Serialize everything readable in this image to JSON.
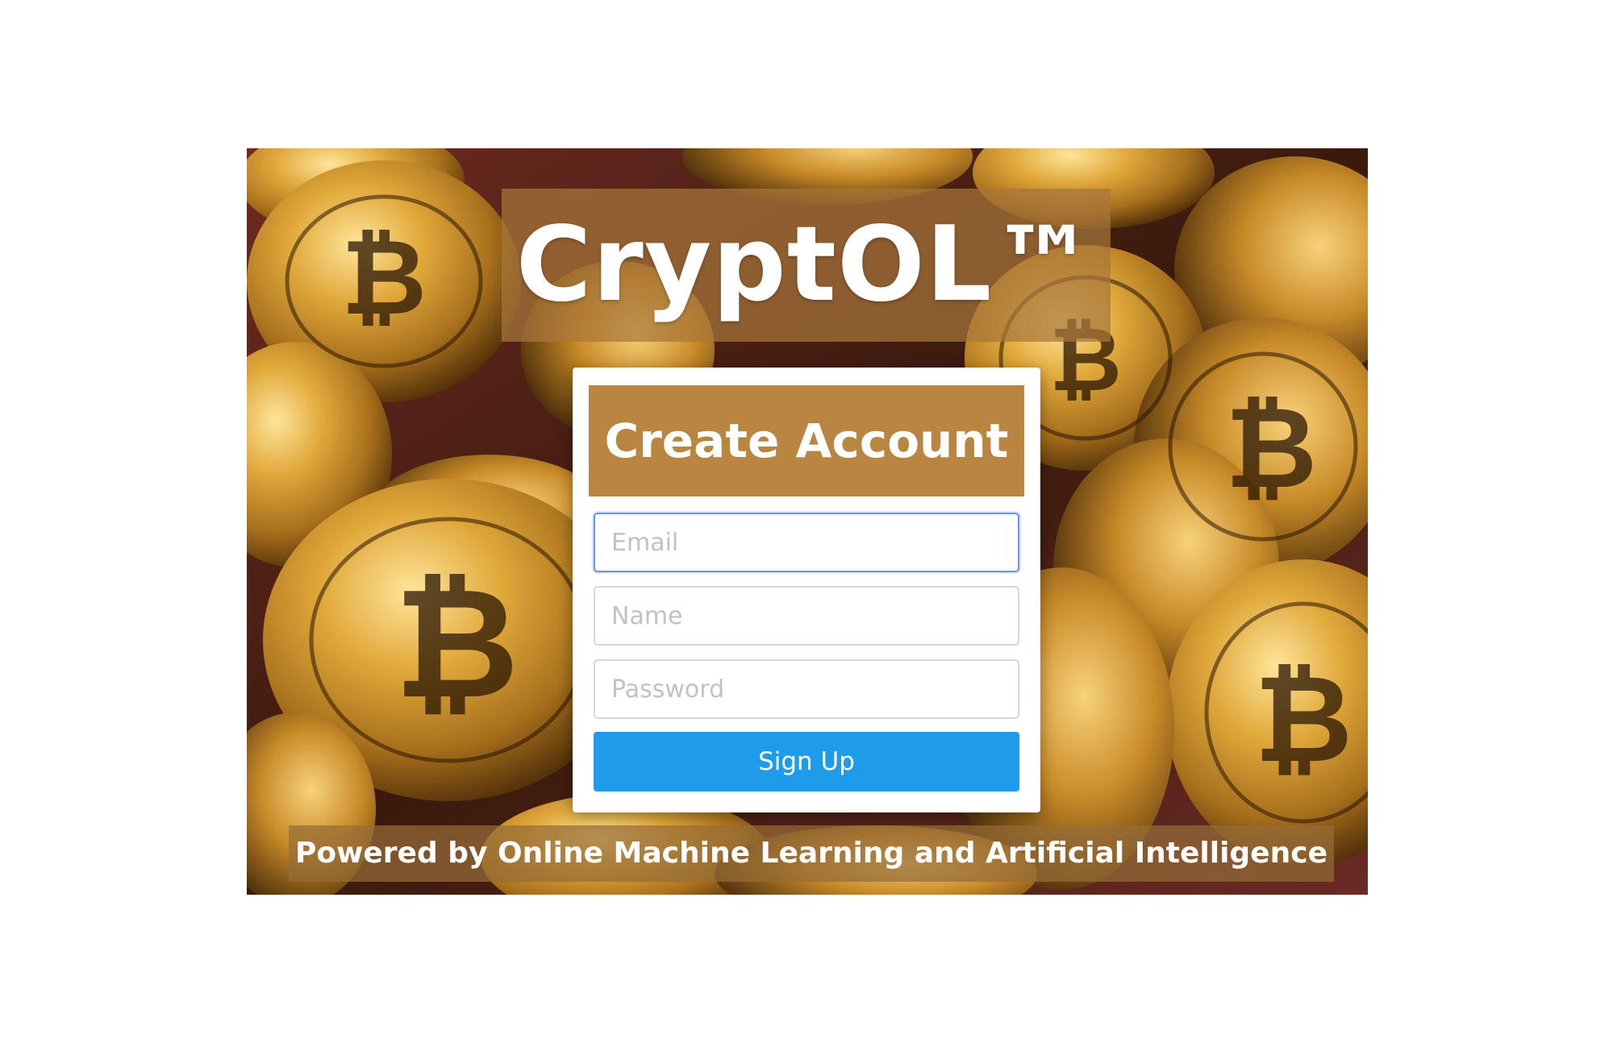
{
  "brand": {
    "title": "CryptOL™"
  },
  "signup_form": {
    "title": "Create Account",
    "email_placeholder": "Email",
    "name_placeholder": "Name",
    "password_placeholder": "Password",
    "submit_label": "Sign Up"
  },
  "footer": {
    "tagline": "Powered by Online Machine Learning and Artificial Intelligence"
  },
  "background": {
    "image_subject": "bitcoin-coins-pile",
    "colors": {
      "gold": "#c8962e",
      "dark": "#3a2008",
      "fabric_red": "#7a2a28"
    }
  },
  "colors": {
    "header_accent": "#b88640",
    "button_blue": "#1e9be9",
    "focus_border": "#6a94e8"
  }
}
